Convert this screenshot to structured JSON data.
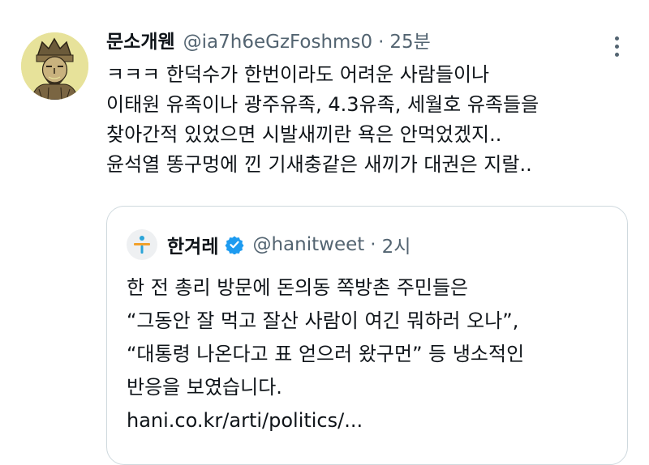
{
  "tweet": {
    "display_name": "문소개웬",
    "handle": "@ia7h6eGzFoshms0",
    "separator": "·",
    "time": "25분",
    "text_lines": [
      "ㅋㅋㅋ 한덕수가 한번이라도 어려운 사람들이나",
      "이태원 유족이나 광주유족, 4.3유족, 세월호 유족들을",
      "찾아간적 있었으면 시발새끼란 욕은 안먹었겠지..",
      "윤석열 똥구멍에 낀 기새충같은 새끼가 대권은 지랄.."
    ],
    "avatar_icon": "warrior-portrait-avatar",
    "more_icon": "more-vertical-icon"
  },
  "quote": {
    "display_name": "한겨레",
    "handle": "@hanitweet",
    "separator": "·",
    "time": "2시",
    "logo_icon": "hankyoreh-logo",
    "verified_icon": "verified-badge-icon",
    "text_lines": [
      "한 전 총리 방문에 돈의동 쪽방촌 주민들은",
      "“그동안 잘 먹고 잘산 사람이 여긴 뭐하러 오나”,",
      "“대통령 나온다고 표 얻으러 왔구먼” 등 냉소적인",
      "반응을 보였습니다.",
      "hani.co.kr/arti/politics/..."
    ]
  },
  "colors": {
    "text": "#0f1419",
    "secondary": "#536471",
    "border": "#cfd9de",
    "verified": "#1d9bf0",
    "avatar_bg": "#e7e29a"
  }
}
